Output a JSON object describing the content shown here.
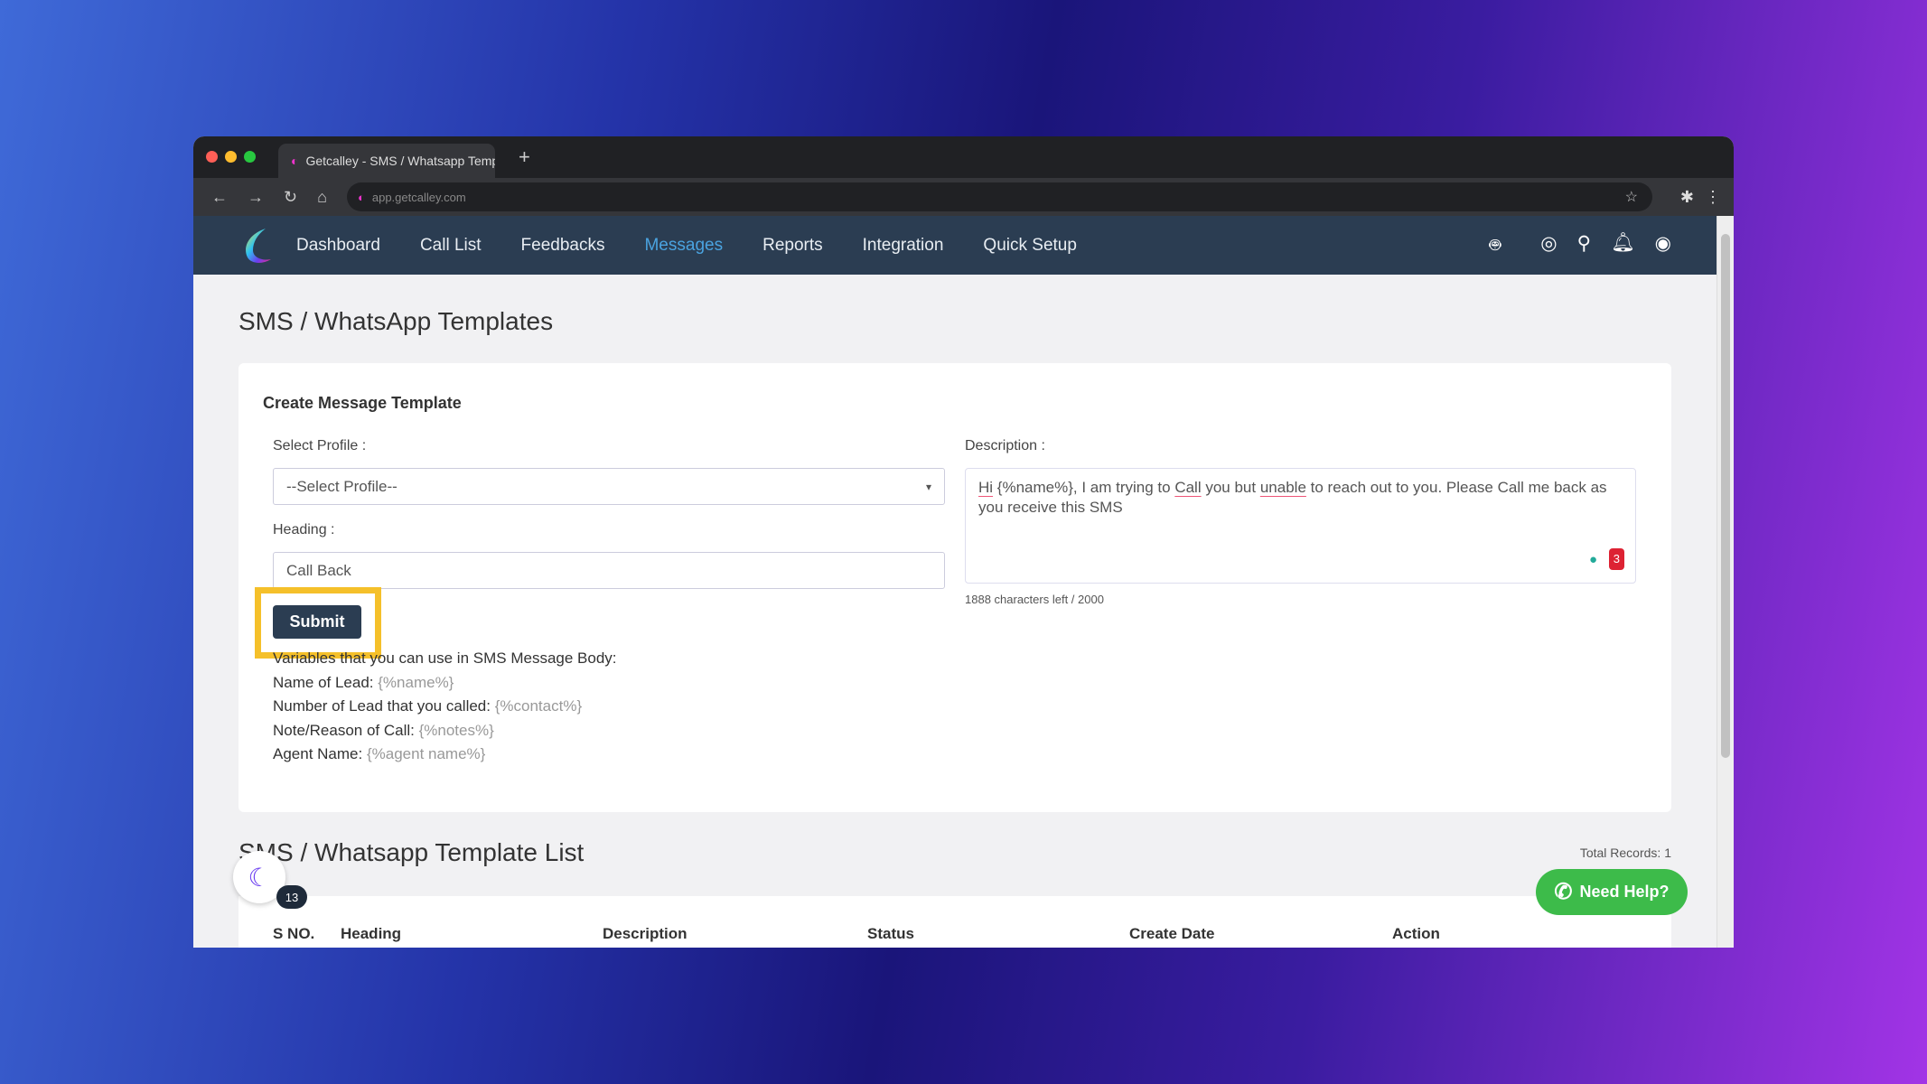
{
  "browser": {
    "tab_title": "Getcalley - SMS / Whatsapp Temp",
    "url": "app.getcalley.com"
  },
  "nav": {
    "items": [
      {
        "label": "Dashboard"
      },
      {
        "label": "Call List"
      },
      {
        "label": "Feedbacks"
      },
      {
        "label": "Messages",
        "active": true
      },
      {
        "label": "Reports"
      },
      {
        "label": "Integration"
      },
      {
        "label": "Quick Setup"
      }
    ],
    "icons": [
      "android-icon",
      "apple-icon",
      "support-icon",
      "search-icon",
      "bell-icon",
      "user-icon"
    ],
    "active_color": "#4aa3e0"
  },
  "page": {
    "title": "SMS / WhatsApp Templates"
  },
  "form": {
    "title": "Create Message Template",
    "profile_label": "Select Profile :",
    "profile_value": "--Select Profile--",
    "heading_label": "Heading :",
    "heading_value": "Call Back",
    "submit_label": "Submit",
    "description_label": "Description :",
    "description_parts": [
      "Hi",
      " {%name%}, I am trying to ",
      "Call",
      " you but ",
      "unable",
      " to reach out to you. Please Call me back as you receive this SMS"
    ],
    "char_count": "1888 characters left / 2000",
    "variables_title": "Variables that you can use in SMS Message Body:",
    "variables": [
      {
        "label": "Name of Lead:",
        "value": "{%name%}"
      },
      {
        "label": "Number of Lead that you called:",
        "value": "{%contact%}"
      },
      {
        "label": "Note/Reason of Call:",
        "value": "{%notes%}"
      },
      {
        "label": "Agent Name:",
        "value": "{%agent name%}"
      }
    ]
  },
  "list": {
    "title": "SMS / Whatsapp Template List",
    "total_records": "Total Records: 1",
    "columns": [
      "S NO.",
      "Heading",
      "Description",
      "Status",
      "Create Date",
      "Action"
    ]
  },
  "widgets": {
    "help_label": "Need Help?",
    "badge_count": "13",
    "help_color": "#3dbb4a"
  }
}
